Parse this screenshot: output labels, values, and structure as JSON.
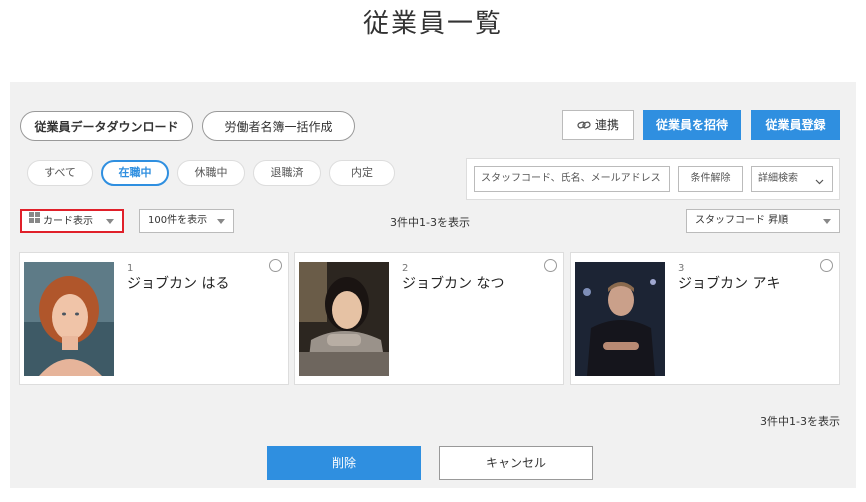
{
  "page": {
    "title": "従業員一覧"
  },
  "toolbar": {
    "download_label": "従業員データダウンロード",
    "roster_label": "労働者名簿一括作成",
    "link_label": "連携",
    "invite_label": "従業員を招待",
    "register_label": "従業員登録"
  },
  "status_filters": [
    {
      "label": "すべて"
    },
    {
      "label": "在職中"
    },
    {
      "label": "休職中"
    },
    {
      "label": "退職済"
    },
    {
      "label": "内定"
    }
  ],
  "search": {
    "placeholder": "スタッフコード、氏名、メールアドレス",
    "clear_label": "条件解除",
    "advanced_label": "詳細検索"
  },
  "view": {
    "mode_label": "カード表示",
    "per_page_label": "100件を表示",
    "count_text": "3件中1-3を表示",
    "sort_label": "スタッフコード 昇順"
  },
  "employees": [
    {
      "num": "1",
      "name": "ジョブカン はる"
    },
    {
      "num": "2",
      "name": "ジョブカン なつ"
    },
    {
      "num": "3",
      "name": "ジョブカン アキ"
    }
  ],
  "footer": {
    "count_text": "3件中1-3を表示",
    "delete_label": "削除",
    "cancel_label": "キャンセル"
  },
  "colors": {
    "accent": "#2f8fe0",
    "highlight": "#e0202a"
  }
}
